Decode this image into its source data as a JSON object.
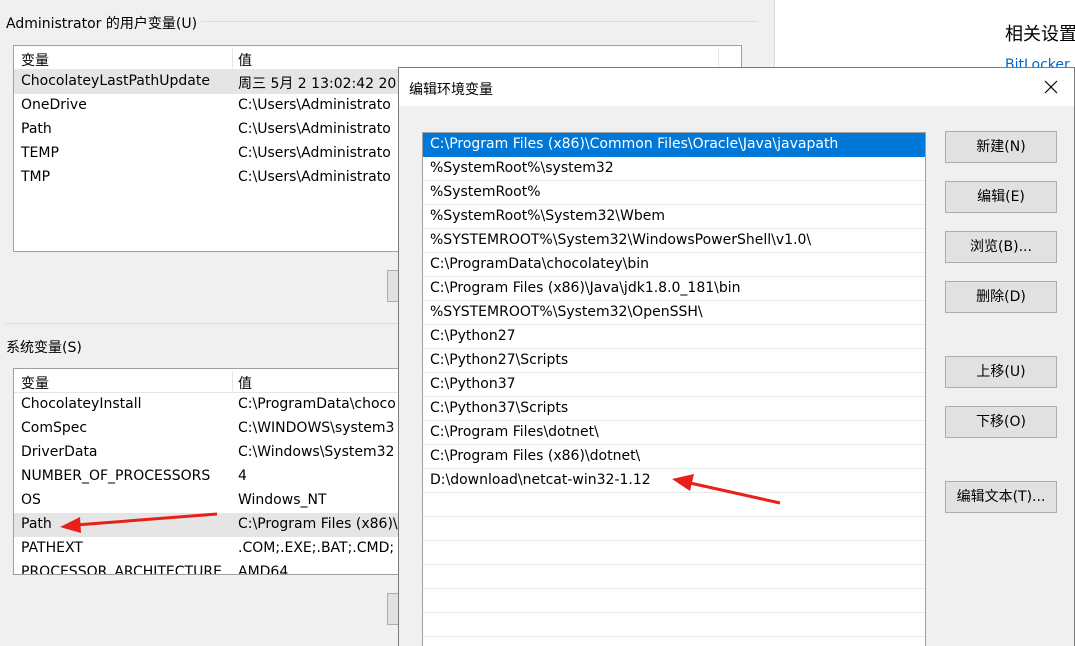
{
  "background_window": {
    "user_vars": {
      "title": "Administrator 的用户变量(U)",
      "columns": [
        "变量",
        "值"
      ],
      "rows": [
        {
          "name": "ChocolateyLastPathUpdate",
          "value": "周三 5月  2 13:02:42 20"
        },
        {
          "name": "OneDrive",
          "value": "C:\\Users\\Administrato"
        },
        {
          "name": "Path",
          "value": "C:\\Users\\Administrato"
        },
        {
          "name": "TEMP",
          "value": "C:\\Users\\Administrato"
        },
        {
          "name": "TMP",
          "value": "C:\\Users\\Administrato"
        }
      ]
    },
    "system_vars": {
      "title": "系统变量(S)",
      "columns": [
        "变量",
        "值"
      ],
      "rows": [
        {
          "name": "ChocolateyInstall",
          "value": "C:\\ProgramData\\choco"
        },
        {
          "name": "ComSpec",
          "value": "C:\\WINDOWS\\system3"
        },
        {
          "name": "DriverData",
          "value": "C:\\Windows\\System32"
        },
        {
          "name": "NUMBER_OF_PROCESSORS",
          "value": "4"
        },
        {
          "name": "OS",
          "value": "Windows_NT"
        },
        {
          "name": "Path",
          "value": "C:\\Program Files (x86)\\"
        },
        {
          "name": "PATHEXT",
          "value": ".COM;.EXE;.BAT;.CMD;"
        },
        {
          "name": "PROCESSOR_ARCHITECTURE",
          "value": "AMD64"
        }
      ]
    }
  },
  "settings_pane": {
    "title": "相关设置",
    "link": "BitLocker"
  },
  "dialog": {
    "title": "编辑环境变量",
    "paths": [
      "C:\\Program Files (x86)\\Common Files\\Oracle\\Java\\javapath",
      "%SystemRoot%\\system32",
      "%SystemRoot%",
      "%SystemRoot%\\System32\\Wbem",
      "%SYSTEMROOT%\\System32\\WindowsPowerShell\\v1.0\\",
      "C:\\ProgramData\\chocolatey\\bin",
      "C:\\Program Files (x86)\\Java\\jdk1.8.0_181\\bin",
      "%SYSTEMROOT%\\System32\\OpenSSH\\",
      "C:\\Python27",
      "C:\\Python27\\Scripts",
      "C:\\Python37",
      "C:\\Python37\\Scripts",
      "C:\\Program Files\\dotnet\\",
      "C:\\Program Files (x86)\\dotnet\\",
      "D:\\download\\netcat-win32-1.12",
      "",
      "",
      "",
      "",
      "",
      "",
      ""
    ],
    "buttons": {
      "new": "新建(N)",
      "edit": "编辑(E)",
      "browse": "浏览(B)...",
      "delete": "删除(D)",
      "move_up": "上移(U)",
      "move_down": "下移(O)",
      "edit_text": "编辑文本(T)..."
    }
  },
  "colors": {
    "selection": "#0078d7",
    "annotation_arrow": "#e8201a",
    "link": "#0066cc"
  }
}
